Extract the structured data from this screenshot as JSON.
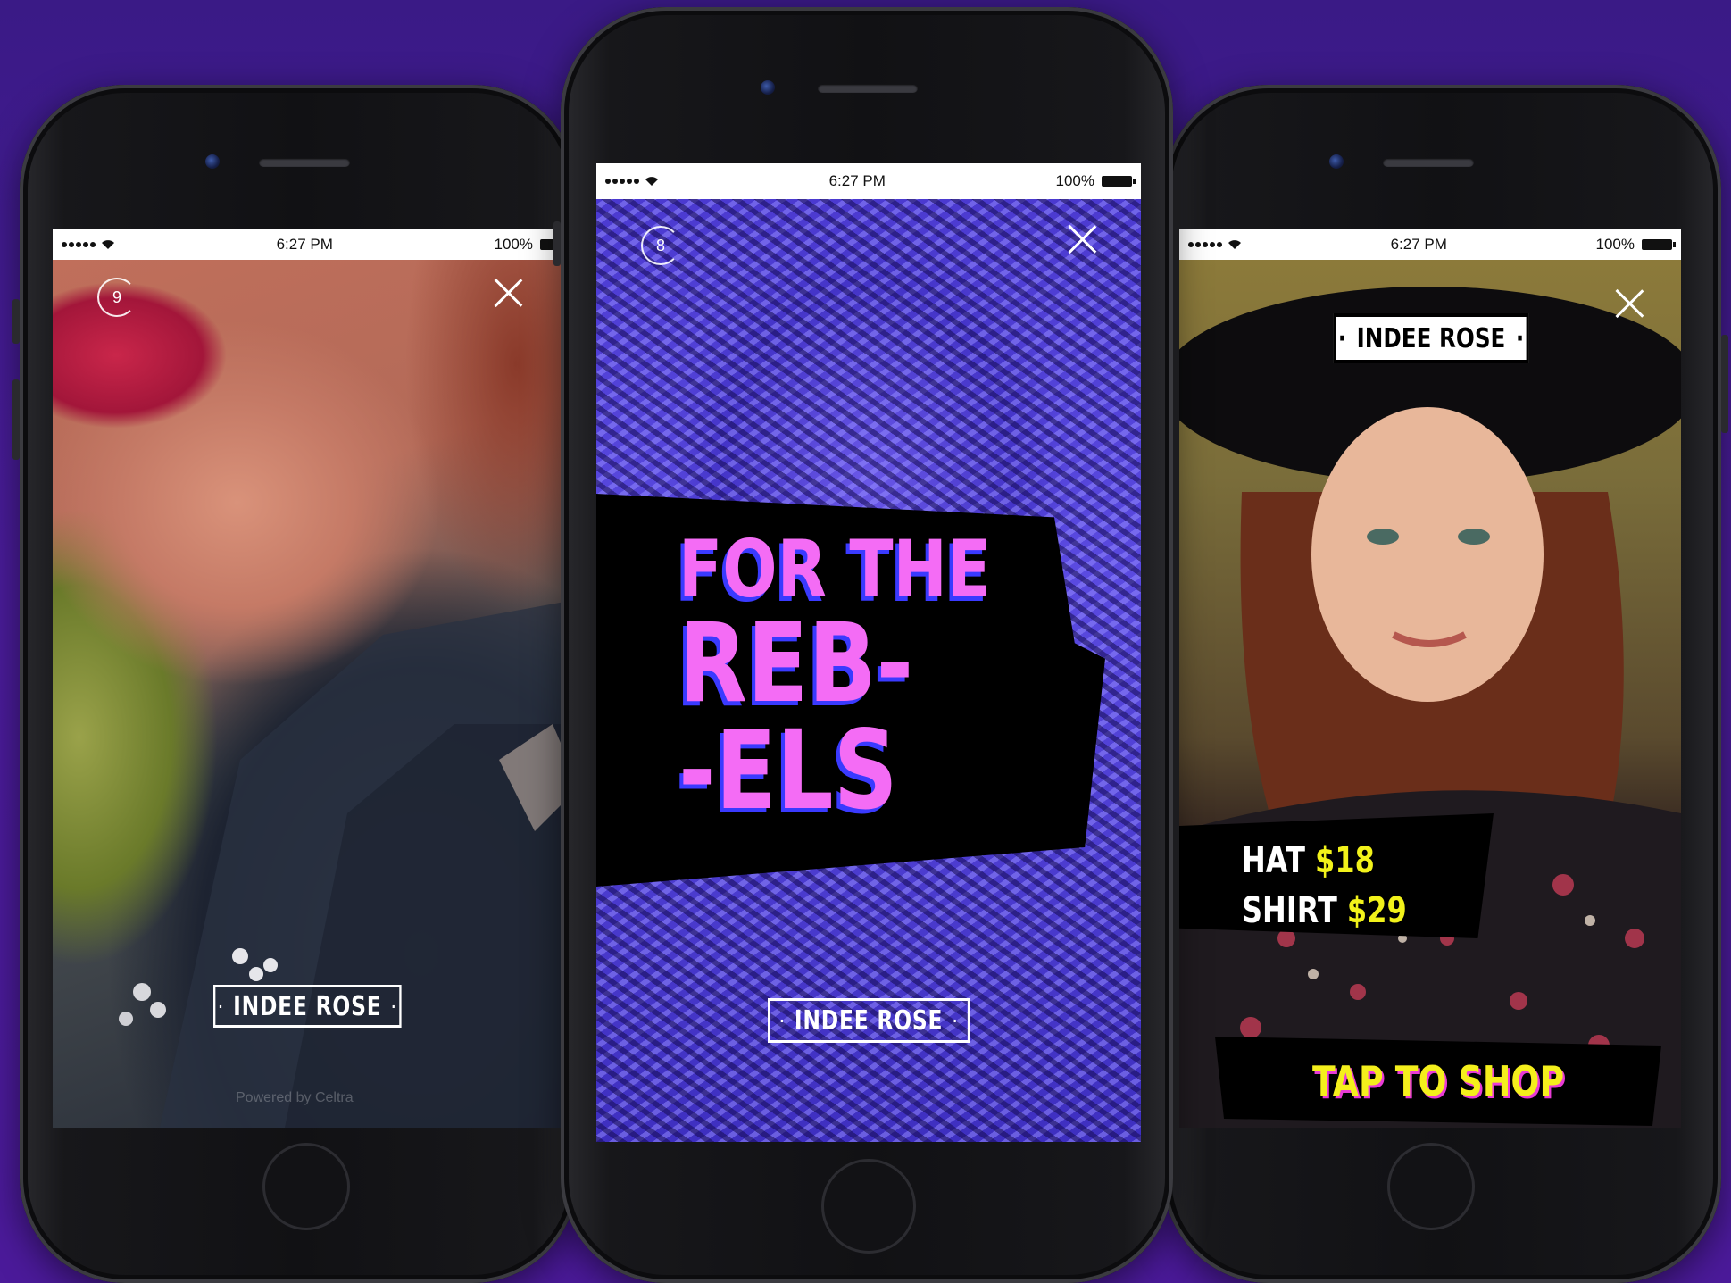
{
  "status_bar": {
    "time": "6:27 PM",
    "battery": "100%"
  },
  "phones": [
    {
      "timer": "9",
      "brand": "INDEE ROSE",
      "credit": "Powered by Celtra"
    },
    {
      "timer": "8",
      "headline_line1": "FOR THE",
      "headline_line2": "REB-",
      "headline_line3": "-ELS",
      "brand": "INDEE ROSE"
    },
    {
      "brand": "INDEE ROSE",
      "price_hat_label": "HAT",
      "price_hat_value": "$18",
      "price_shirt_label": "SHIRT",
      "price_shirt_value": "$29",
      "cta": "TAP TO SHOP"
    }
  ],
  "colors": {
    "background": "#4a1c9a",
    "headline_pink": "#f46cf5",
    "headline_shadow": "#3a3aff",
    "price_yellow": "#f2f21a",
    "cta_yellow": "#f4ef1c",
    "cta_shadow": "#e93bd6"
  },
  "icons": [
    "wifi-icon",
    "battery-icon",
    "close-icon",
    "timer-ring-icon",
    "camera-icon",
    "home-button-icon"
  ]
}
